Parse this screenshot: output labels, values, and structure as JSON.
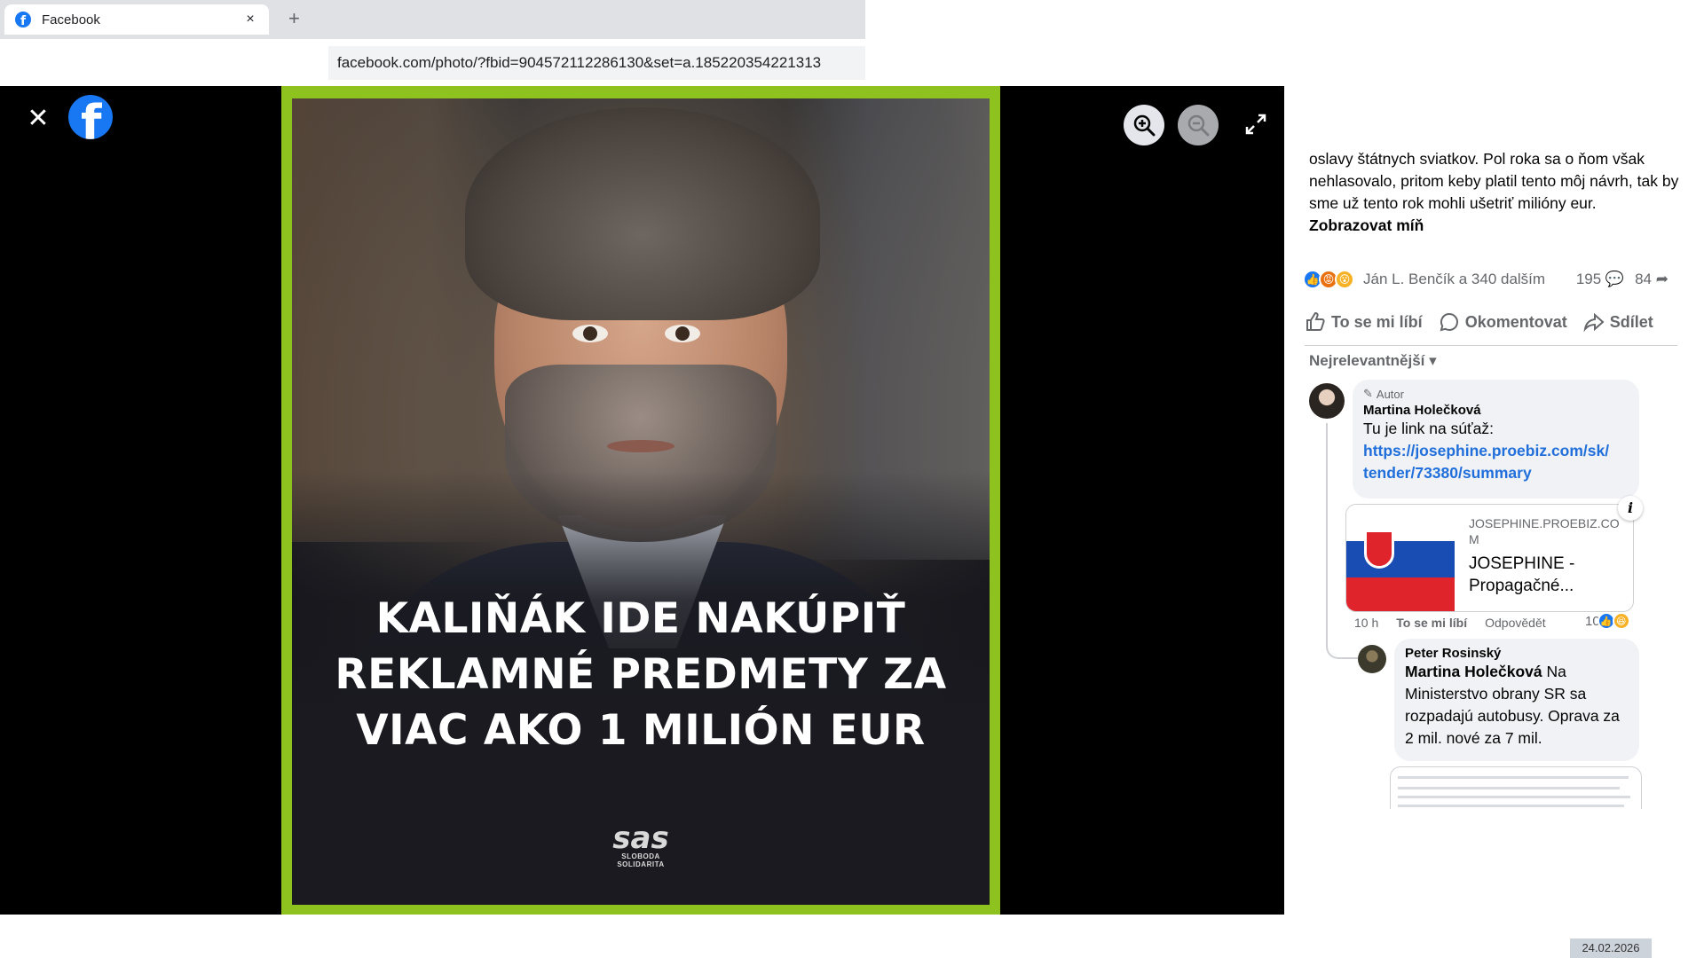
{
  "browser": {
    "tab_title": "Facebook",
    "tab_close": "×",
    "new_tab": "+",
    "url": "facebook.com/photo/?fbid=904572112286130&set=a.185220354221313"
  },
  "viewer": {
    "close": "✕",
    "photo_headline": "KALIŇÁK IDE NAKÚPIŤ REKLAMNÉ PREDMETY ZA VIAC AKO 1 MILIÓN EUR",
    "logo_mark": "sas",
    "logo_sub_1": "SLOBODA",
    "logo_sub_2": "SOLIDARITA"
  },
  "post": {
    "text": "oslavy štátnych sviatkov. Pol roka sa o ňom však nehlasovalo, pritom keby platil tento môj návrh, tak by sme už tento rok mohli ušetriť milióny eur.",
    "show_less": "Zobrazovat míň",
    "reactions_names": "Ján L. Benčík a 340 dalším",
    "comments_count": "195",
    "shares_count": "84",
    "actions": {
      "like": "To se mi líbí",
      "comment": "Okomentovat",
      "share": "Sdílet"
    },
    "sort_label": "Nejrelevantnější"
  },
  "comments": {
    "c1": {
      "badge": "Autor",
      "author": "Martina Holečková",
      "text": "Tu je link na súťaž:",
      "link_line1": "https://josephine.proebiz.com/sk/",
      "link_line2": "tender/73380/summary",
      "preview_domain": "JOSEPHINE.PROEBIZ.COM",
      "preview_title": "JOSEPHINE - Propagačné...",
      "time": "10 h",
      "like": "To se mi líbí",
      "reply": "Odpovědět",
      "reaction_count": "10"
    },
    "c2": {
      "author": "Peter Rosinský",
      "mention": "Martina Holečková",
      "text": " Na Ministerstvo obrany SR sa rozpadajú autobusy. Oprava za 2 mil. nové za 7 mil."
    }
  },
  "date_stamp": "24.02.2026",
  "colors": {
    "facebook_blue": "#1877f2",
    "frame_green": "#8dc21f",
    "link_blue": "#216fdb"
  }
}
